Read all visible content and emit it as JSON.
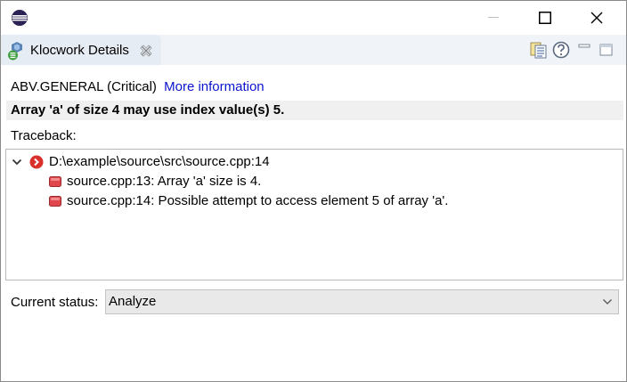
{
  "window": {
    "controls": {
      "minimize": "minimize-icon",
      "maximize": "maximize-icon",
      "close": "close-icon"
    }
  },
  "tab": {
    "label": "Klocwork Details",
    "icon": "klocwork-icon"
  },
  "toolbar": {
    "icons": [
      "document-list-icon",
      "help-icon",
      "minimize-view-icon",
      "maximize-view-icon"
    ]
  },
  "issue": {
    "rule": "ABV.GENERAL (Critical)",
    "more_info": "More information",
    "message": "Array 'a' of size 4 may use index value(s) 5."
  },
  "traceback": {
    "label": "Traceback:",
    "root": "D:\\example\\source\\src\\source.cpp:14",
    "children": [
      "source.cpp:13: Array 'a' size is 4.",
      "source.cpp:14: Possible attempt to access element 5 of array 'a'."
    ]
  },
  "status": {
    "label": "Current status:",
    "value": "Analyze"
  },
  "colors": {
    "link": "#0b14cc",
    "error": "#d9302c",
    "marker": "#e0474c",
    "tab_bg": "#e6ecf4"
  }
}
